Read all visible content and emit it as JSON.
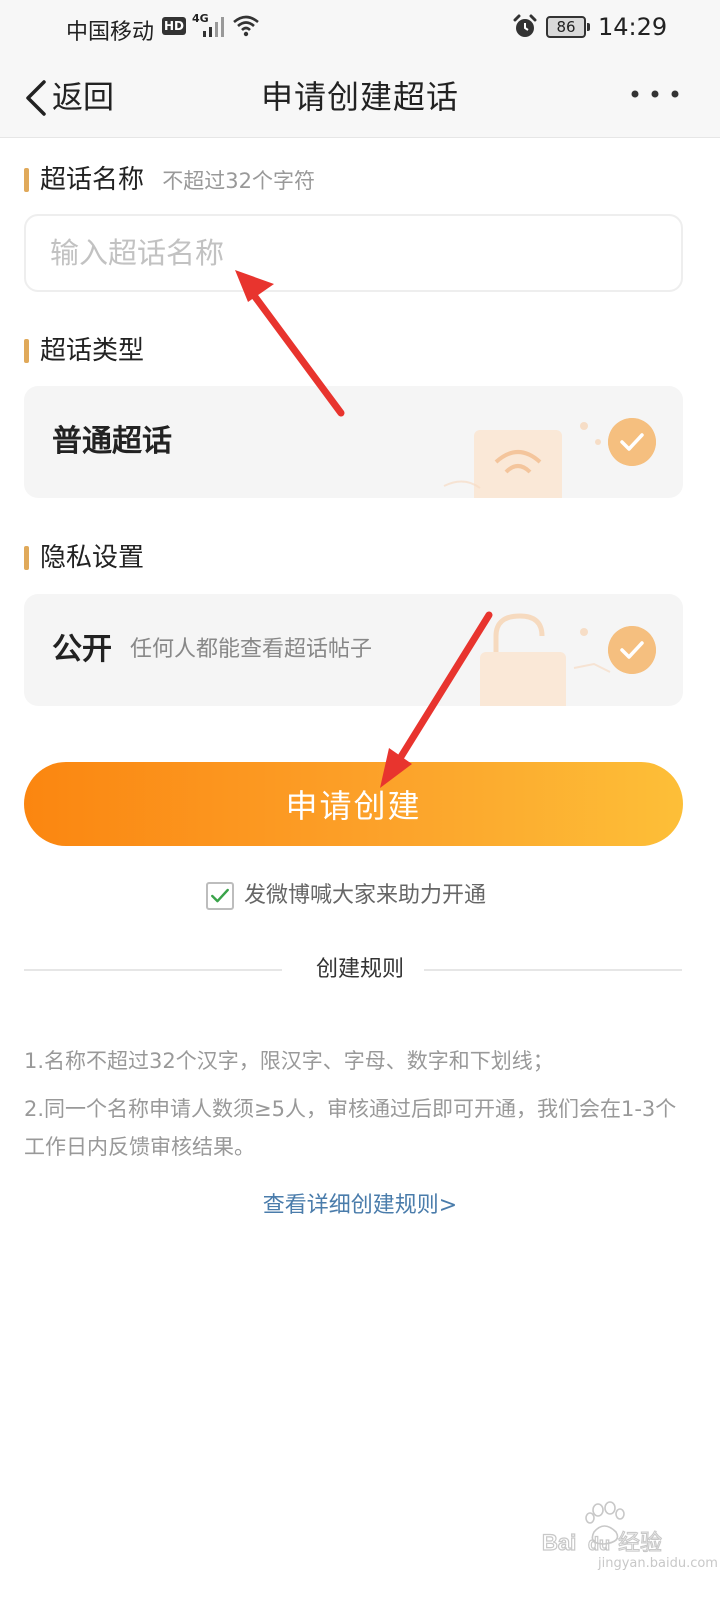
{
  "status_bar": {
    "carrier": "中国移动",
    "hd_badge": "HD",
    "network": "4G",
    "battery": "86",
    "time": "14:29"
  },
  "nav": {
    "back_label": "返回",
    "title": "申请创建超话"
  },
  "name_section": {
    "title": "超话名称",
    "hint": "不超过32个字符",
    "input_placeholder": "输入超话名称",
    "input_value": ""
  },
  "type_section": {
    "title": "超话类型",
    "option_label": "普通超话",
    "selected": true
  },
  "privacy_section": {
    "title": "隐私设置",
    "option_label": "公开",
    "option_desc": "任何人都能查看超话帖子",
    "selected": true
  },
  "submit": {
    "label": "申请创建"
  },
  "share": {
    "label": "发微博喊大家来助力开通",
    "checked": true
  },
  "rules": {
    "heading": "创建规则",
    "items": [
      "1.名称不超过32个汉字，限汉字、字母、数字和下划线；",
      "2.同一个名称申请人数须≥5人，审核通过后即可开通，我们会在1-3个工作日内反馈审核结果。"
    ],
    "link": "查看详细创建规则>"
  },
  "watermark": {
    "logo_text": "Bai du 经验",
    "url": "jingyan.baidu.com"
  },
  "colors": {
    "accent_bar": "#e0a95a",
    "check_fill": "#f5bf7f",
    "button_start": "#fb8610",
    "button_end": "#fdbf38",
    "link": "#4a7cab",
    "annotation_arrow": "#e8342e"
  },
  "icons": {
    "back": "chevron-left-icon",
    "more": "more-dots-icon",
    "check": "check-circle-icon",
    "checkbox": "checkbox-checked-icon"
  }
}
